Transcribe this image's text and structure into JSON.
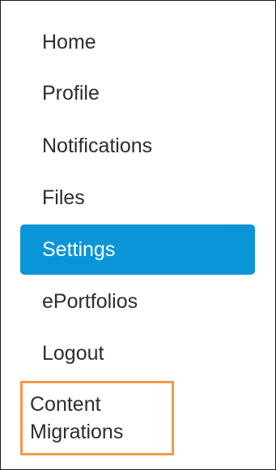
{
  "nav": {
    "items": [
      {
        "label": "Home"
      },
      {
        "label": "Profile"
      },
      {
        "label": "Notifications"
      },
      {
        "label": "Files"
      },
      {
        "label": "Settings"
      },
      {
        "label": "ePortfolios"
      },
      {
        "label": "Logout"
      },
      {
        "label": "Content Migrations"
      }
    ]
  },
  "colors": {
    "active_background": "#0a95d8",
    "highlight_border": "#f39a45"
  }
}
